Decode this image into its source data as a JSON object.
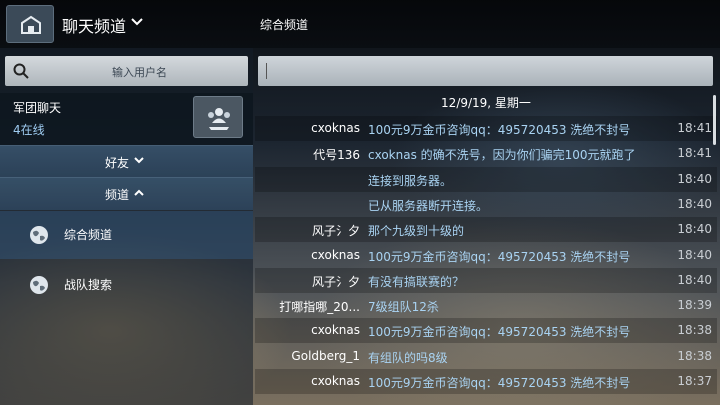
{
  "header": {
    "title": "聊天频道",
    "current_channel": "综合频道"
  },
  "sidebar": {
    "search": {
      "placeholder": "输入用户名",
      "value": ""
    },
    "legion": {
      "name": "军团聊天",
      "online": "4在线"
    },
    "sections": [
      {
        "label": "好友",
        "expanded": false
      },
      {
        "label": "频道",
        "expanded": true
      }
    ],
    "channels": [
      {
        "label": "综合频道",
        "active": true
      },
      {
        "label": "战队搜索",
        "active": false
      }
    ]
  },
  "chat": {
    "input_value": "",
    "date": "12/9/19, 星期一",
    "messages": [
      {
        "sender": "cxoknas",
        "text": "100元9万金币咨询qq：495720453 洗绝不封号",
        "time": "18:41"
      },
      {
        "sender": "代号136",
        "text": "cxoknas 的确不洗号，因为你们骗完100元就跑了",
        "time": "18:41"
      },
      {
        "sender": "",
        "text": "连接到服务器。",
        "time": "18:40"
      },
      {
        "sender": "",
        "text": "已从服务器断开连接。",
        "time": "18:40"
      },
      {
        "sender": "风子氵夕",
        "text": "那个九级到十级的",
        "time": "18:40"
      },
      {
        "sender": "cxoknas",
        "text": "100元9万金币咨询qq：495720453 洗绝不封号",
        "time": "18:40"
      },
      {
        "sender": "风子氵夕",
        "text": "有没有搞联赛的？",
        "time": "18:40"
      },
      {
        "sender": "打哪指哪_20...",
        "text": "7级组队12杀",
        "time": "18:39"
      },
      {
        "sender": "cxoknas",
        "text": "100元9万金币咨询qq：495720453 洗绝不封号",
        "time": "18:38"
      },
      {
        "sender": "Goldberg_1",
        "text": "有组队的吗8级",
        "time": "18:38"
      },
      {
        "sender": "cxoknas",
        "text": "100元9万金币咨询qq：495720453 洗绝不封号",
        "time": "18:37"
      }
    ]
  },
  "colors": {
    "message_text": "#a9d3f2",
    "section_bg": "#3a5670",
    "active_channel_bg": "#325a82"
  }
}
